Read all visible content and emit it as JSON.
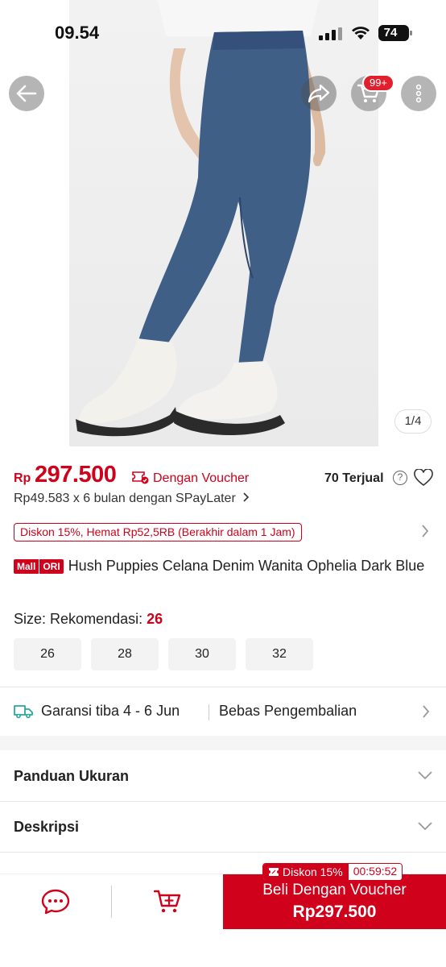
{
  "status_bar": {
    "time": "09.54",
    "battery": "74"
  },
  "header": {
    "back_icon": "arrow-left-icon",
    "share_icon": "share-icon",
    "cart_icon": "cart-icon",
    "cart_badge": "99+",
    "more_icon": "more-vertical-icon"
  },
  "gallery": {
    "counter": "1/4"
  },
  "price": {
    "currency": "Rp",
    "amount": "297.500",
    "voucher_label": "Dengan Voucher",
    "sold": "70 Terjual",
    "installment": "Rp49.583 x 6 bulan dengan SPayLater"
  },
  "discount_tag": "Diskon 15%, Hemat Rp52,5RB (Berakhir dalam 1 Jam)",
  "product": {
    "badge_mall": "Mall",
    "badge_ori": "ORI",
    "title": "Hush Puppies Celana Denim Wanita Ophelia Dark Blue"
  },
  "size": {
    "label": "Size:",
    "recommend_label": "Rekomendasi:",
    "recommend_value": "26",
    "options": [
      "26",
      "28",
      "30",
      "32"
    ]
  },
  "shipping": {
    "guarantee": "Garansi tiba 4 - 6 Jun",
    "returns": "Bebas Pengembalian"
  },
  "accordions": [
    {
      "label": "Panduan Ukuran"
    },
    {
      "label": "Deskripsi"
    }
  ],
  "bottom_bar": {
    "buy_label": "Beli Dengan Voucher",
    "buy_price": "Rp297.500",
    "promo_label": "Diskon 15%",
    "promo_timer": "00:59:52"
  },
  "colors": {
    "brand_red": "#d0011b",
    "badge_red": "#e0202e",
    "shipping_green": "#26aa99"
  }
}
